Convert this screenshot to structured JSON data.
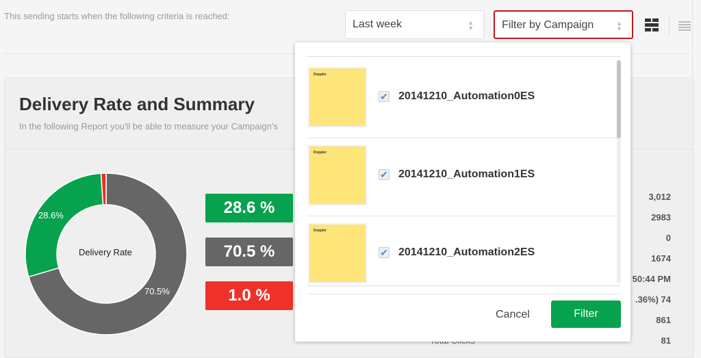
{
  "header": {
    "criteria_text": "This sending starts when the following criteria is reached:",
    "period_select": "Last week",
    "campaign_select": "Filter by Campaign",
    "icons": [
      "grid-view-icon",
      "list-view-icon"
    ]
  },
  "report": {
    "title": "Delivery Rate and Summary",
    "subtitle": "In the following Report you'll be able to measure your Campaign's",
    "chart_data": {
      "type": "pie",
      "center_label": "Delivery Rate",
      "slices": [
        {
          "value": 70.5,
          "label": "70.5%",
          "color": "#666666"
        },
        {
          "value": 28.6,
          "label": "28.6%",
          "color": "#07a24d"
        },
        {
          "value": 1.0,
          "label": "",
          "color": "#e8312a"
        }
      ]
    },
    "pills": [
      {
        "label": "28.6 %",
        "color": "#07a24d"
      },
      {
        "label": "70.5 %",
        "color": "#666666"
      },
      {
        "label": "1.0 %",
        "color": "#f0312a"
      }
    ],
    "stats": [
      "3,012",
      "2983",
      "0",
      "1674",
      "50:44 PM",
      ".36%) 74",
      "861",
      "81"
    ],
    "partial_label": "Total Clicks"
  },
  "popup": {
    "items": [
      {
        "name": "20141210_Automation0ES",
        "checked": true,
        "thumb_logo": "Doppler"
      },
      {
        "name": "20141210_Automation1ES",
        "checked": true,
        "thumb_logo": "Doppler"
      },
      {
        "name": "20141210_Automation2ES",
        "checked": true,
        "thumb_logo": "Doppler"
      }
    ],
    "cancel": "Cancel",
    "filter": "Filter"
  }
}
